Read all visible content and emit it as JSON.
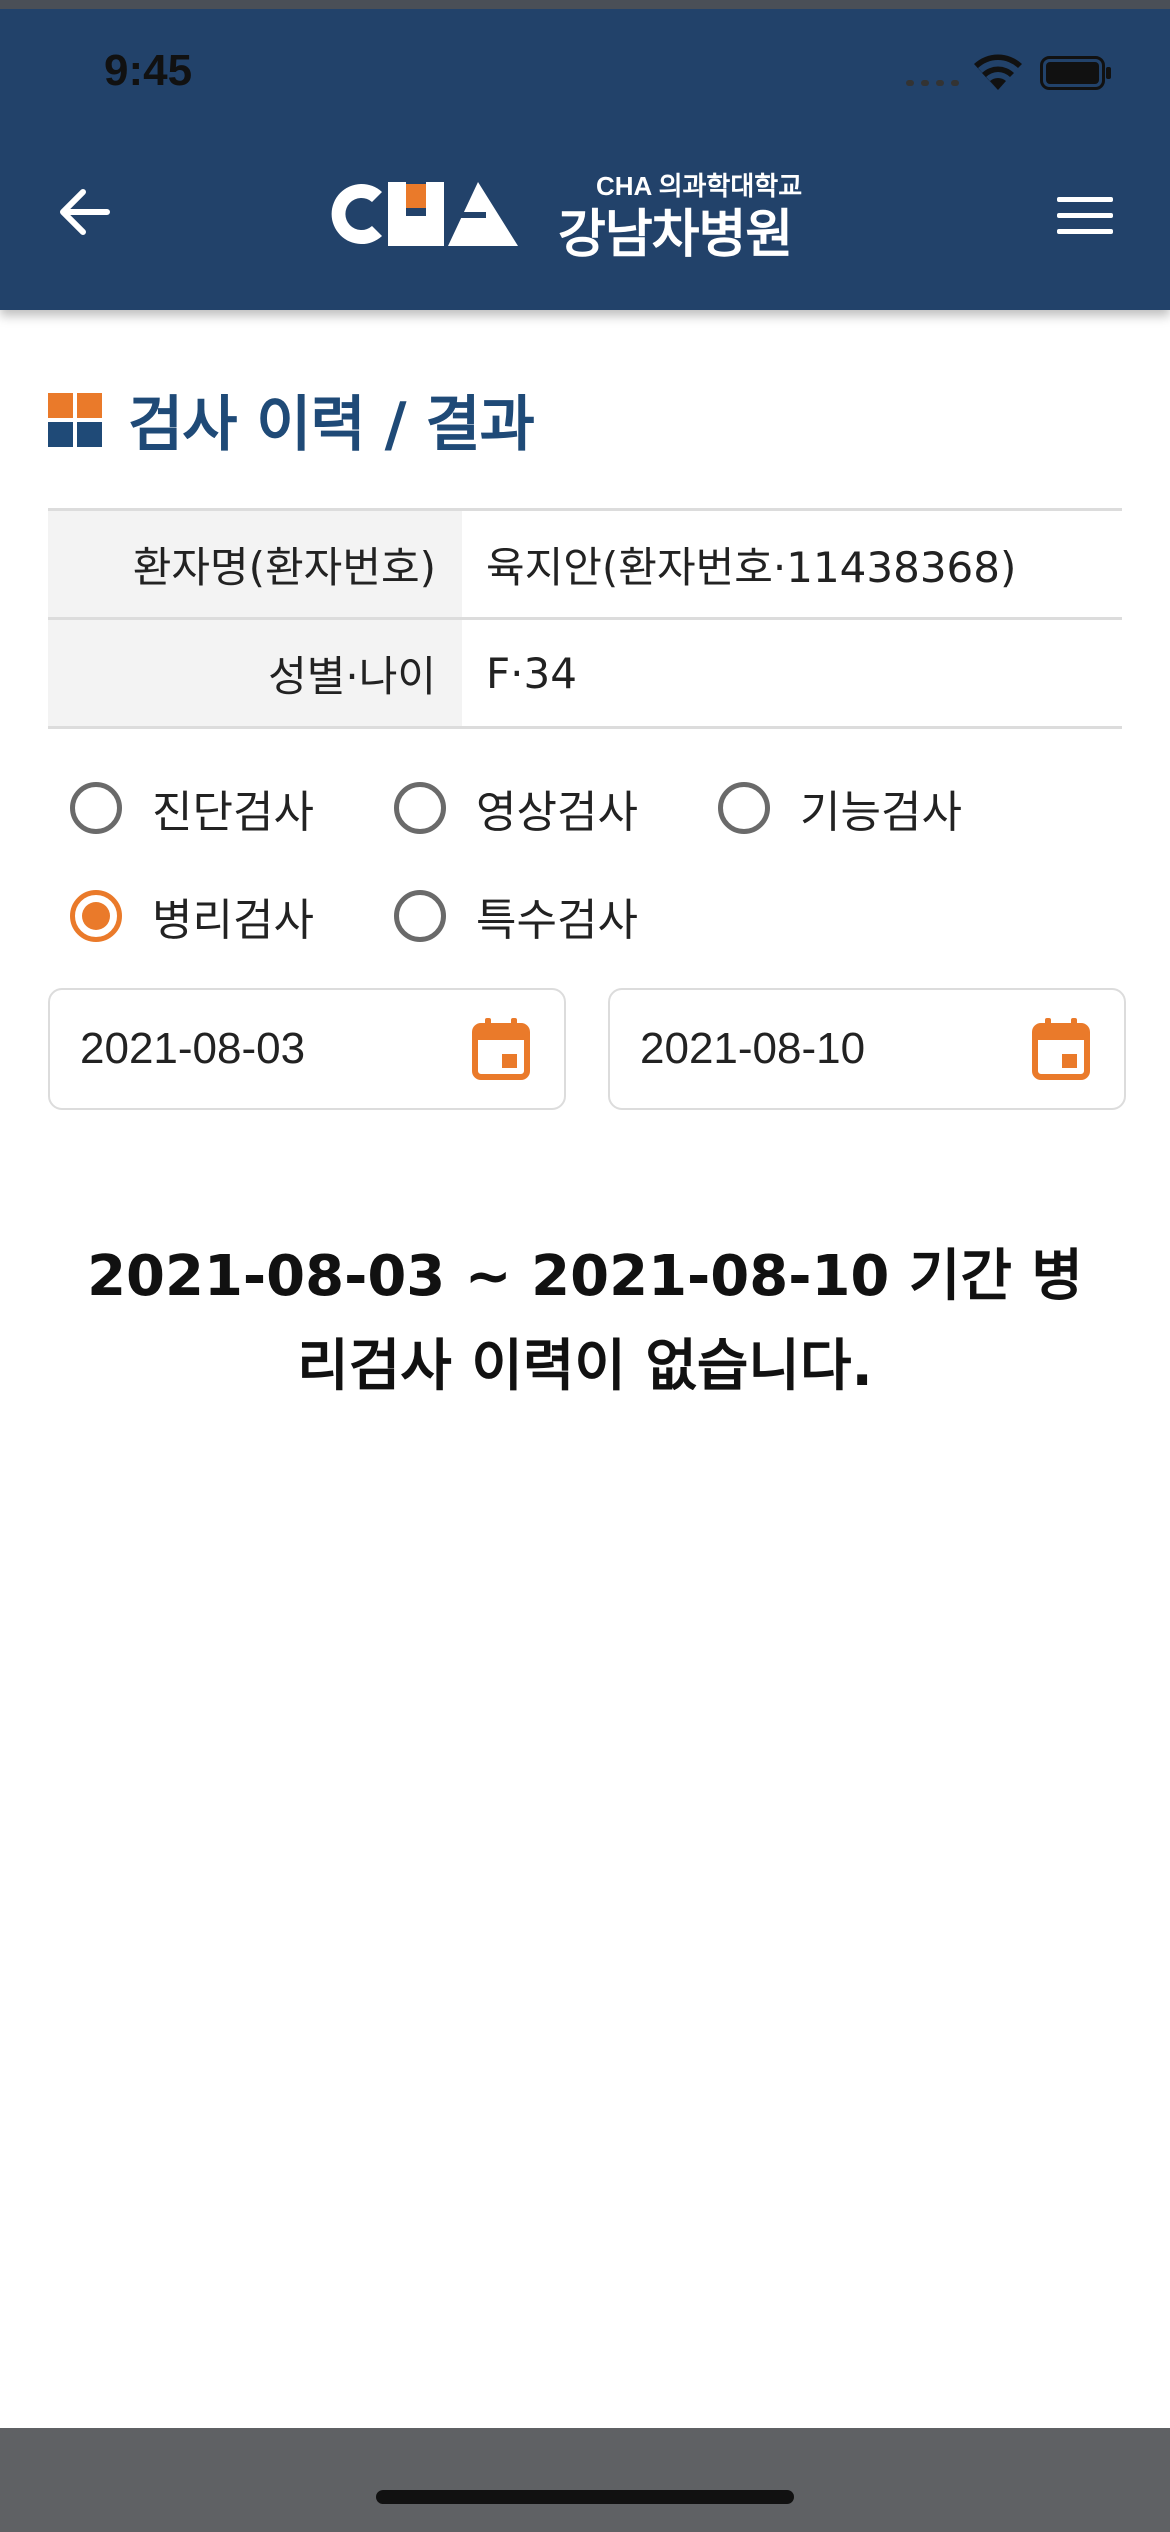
{
  "status_bar": {
    "time": "9:45"
  },
  "header": {
    "logo_mark_text": "CHA",
    "logo_subtitle": "CHA 의과학대학교",
    "logo_name": "강남차병원",
    "back_icon": "arrow-left-icon",
    "menu_icon": "hamburger-menu-icon"
  },
  "page": {
    "title": "검사 이력 / 결과"
  },
  "patient_info": {
    "rows": [
      {
        "label": "환자명(환자번호)",
        "value": "육지안(환자번호·11438368)"
      },
      {
        "label": "성별·나이",
        "value": "F·34"
      }
    ]
  },
  "test_types": {
    "options": [
      {
        "label": "진단검사",
        "checked": false
      },
      {
        "label": "영상검사",
        "checked": false
      },
      {
        "label": "기능검사",
        "checked": false
      },
      {
        "label": "병리검사",
        "checked": true
      },
      {
        "label": "특수검사",
        "checked": false
      }
    ]
  },
  "date_range": {
    "start": "2021-08-03",
    "end": "2021-08-10",
    "icon": "calendar-icon"
  },
  "empty_message": {
    "line1": "2021-08-03 ~ 2021-08-10 기간 병",
    "line2": "리검사 이력이 없습니다."
  },
  "colors": {
    "header_bg": "#22426a",
    "accent": "#ea7a2a",
    "title_blue": "#1f4a77"
  }
}
